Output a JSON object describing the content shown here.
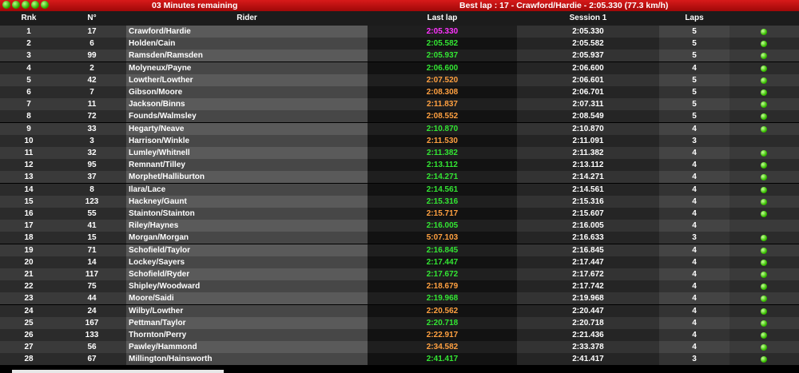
{
  "header": {
    "lights": 5,
    "remaining": "03 Minutes remaining",
    "best_lap": "Best lap : 17 - Crawford/Hardie - 2:05.330 (77.3 km/h)"
  },
  "columns": {
    "rank": "Rnk",
    "number": "N°",
    "rider": "Rider",
    "last_lap": "Last lap",
    "session": "Session 1",
    "laps": "Laps"
  },
  "colors": {
    "purple": "#ff33ff",
    "green": "#33e633",
    "orange": "#ffa040"
  },
  "rows": [
    {
      "rnk": "1",
      "no": "17",
      "rider": "Crawford/Hardie",
      "last": "2:05.330",
      "last_color": "purple",
      "session": "2:05.330",
      "laps": "5",
      "on_track": true
    },
    {
      "rnk": "2",
      "no": "6",
      "rider": "Holden/Cain",
      "last": "2:05.582",
      "last_color": "green",
      "session": "2:05.582",
      "laps": "5",
      "on_track": true
    },
    {
      "rnk": "3",
      "no": "99",
      "rider": "Ramsden/Ramsden",
      "last": "2:05.937",
      "last_color": "green",
      "session": "2:05.937",
      "laps": "5",
      "on_track": true
    },
    {
      "rnk": "4",
      "no": "2",
      "rider": "Molyneux/Payne",
      "last": "2:06.600",
      "last_color": "green",
      "session": "2:06.600",
      "laps": "4",
      "on_track": true
    },
    {
      "rnk": "5",
      "no": "42",
      "rider": "Lowther/Lowther",
      "last": "2:07.520",
      "last_color": "orange",
      "session": "2:06.601",
      "laps": "5",
      "on_track": true
    },
    {
      "rnk": "6",
      "no": "7",
      "rider": "Gibson/Moore",
      "last": "2:08.308",
      "last_color": "orange",
      "session": "2:06.701",
      "laps": "5",
      "on_track": true
    },
    {
      "rnk": "7",
      "no": "11",
      "rider": "Jackson/Binns",
      "last": "2:11.837",
      "last_color": "orange",
      "session": "2:07.311",
      "laps": "5",
      "on_track": true
    },
    {
      "rnk": "8",
      "no": "72",
      "rider": "Founds/Walmsley",
      "last": "2:08.552",
      "last_color": "orange",
      "session": "2:08.549",
      "laps": "5",
      "on_track": true
    },
    {
      "rnk": "9",
      "no": "33",
      "rider": "Hegarty/Neave",
      "last": "2:10.870",
      "last_color": "green",
      "session": "2:10.870",
      "laps": "4",
      "on_track": true
    },
    {
      "rnk": "10",
      "no": "3",
      "rider": "Harrison/Winkle",
      "last": "2:11.530",
      "last_color": "orange",
      "session": "2:11.091",
      "laps": "3",
      "on_track": false
    },
    {
      "rnk": "11",
      "no": "32",
      "rider": "Lumley/Whitnell",
      "last": "2:11.382",
      "last_color": "green",
      "session": "2:11.382",
      "laps": "4",
      "on_track": true
    },
    {
      "rnk": "12",
      "no": "95",
      "rider": "Remnant/Tilley",
      "last": "2:13.112",
      "last_color": "green",
      "session": "2:13.112",
      "laps": "4",
      "on_track": true
    },
    {
      "rnk": "13",
      "no": "37",
      "rider": "Morphet/Halliburton",
      "last": "2:14.271",
      "last_color": "green",
      "session": "2:14.271",
      "laps": "4",
      "on_track": true
    },
    {
      "rnk": "14",
      "no": "8",
      "rider": "Ilara/Lace",
      "last": "2:14.561",
      "last_color": "green",
      "session": "2:14.561",
      "laps": "4",
      "on_track": true
    },
    {
      "rnk": "15",
      "no": "123",
      "rider": "Hackney/Gaunt",
      "last": "2:15.316",
      "last_color": "green",
      "session": "2:15.316",
      "laps": "4",
      "on_track": true
    },
    {
      "rnk": "16",
      "no": "55",
      "rider": "Stainton/Stainton",
      "last": "2:15.717",
      "last_color": "orange",
      "session": "2:15.607",
      "laps": "4",
      "on_track": true
    },
    {
      "rnk": "17",
      "no": "41",
      "rider": "Riley/Haynes",
      "last": "2:16.005",
      "last_color": "green",
      "session": "2:16.005",
      "laps": "4",
      "on_track": false
    },
    {
      "rnk": "18",
      "no": "15",
      "rider": "Morgan/Morgan",
      "last": "5:07.103",
      "last_color": "orange",
      "session": "2:16.633",
      "laps": "3",
      "on_track": true
    },
    {
      "rnk": "19",
      "no": "71",
      "rider": "Schofield/Taylor",
      "last": "2:16.845",
      "last_color": "green",
      "session": "2:16.845",
      "laps": "4",
      "on_track": true
    },
    {
      "rnk": "20",
      "no": "14",
      "rider": "Lockey/Sayers",
      "last": "2:17.447",
      "last_color": "green",
      "session": "2:17.447",
      "laps": "4",
      "on_track": true
    },
    {
      "rnk": "21",
      "no": "117",
      "rider": "Schofield/Ryder",
      "last": "2:17.672",
      "last_color": "green",
      "session": "2:17.672",
      "laps": "4",
      "on_track": true
    },
    {
      "rnk": "22",
      "no": "75",
      "rider": "Shipley/Woodward",
      "last": "2:18.679",
      "last_color": "orange",
      "session": "2:17.742",
      "laps": "4",
      "on_track": true
    },
    {
      "rnk": "23",
      "no": "44",
      "rider": "Moore/Saidi",
      "last": "2:19.968",
      "last_color": "green",
      "session": "2:19.968",
      "laps": "4",
      "on_track": true
    },
    {
      "rnk": "24",
      "no": "24",
      "rider": "Wilby/Lowther",
      "last": "2:20.562",
      "last_color": "orange",
      "session": "2:20.447",
      "laps": "4",
      "on_track": true
    },
    {
      "rnk": "25",
      "no": "167",
      "rider": "Pettman/Taylor",
      "last": "2:20.718",
      "last_color": "green",
      "session": "2:20.718",
      "laps": "4",
      "on_track": true
    },
    {
      "rnk": "26",
      "no": "133",
      "rider": "Thornton/Perry",
      "last": "2:22.917",
      "last_color": "orange",
      "session": "2:21.436",
      "laps": "4",
      "on_track": true
    },
    {
      "rnk": "27",
      "no": "56",
      "rider": "Pawley/Hammond",
      "last": "2:34.582",
      "last_color": "orange",
      "session": "2:33.378",
      "laps": "4",
      "on_track": true
    },
    {
      "rnk": "28",
      "no": "67",
      "rider": "Millington/Hainsworth",
      "last": "2:41.417",
      "last_color": "green",
      "session": "2:41.417",
      "laps": "3",
      "on_track": true
    }
  ]
}
